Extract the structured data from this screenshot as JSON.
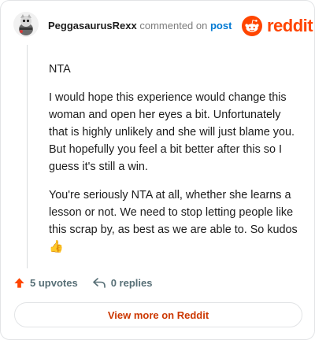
{
  "header": {
    "username": "PeggasaurusRexx",
    "verb": "commented on",
    "post_link": "post"
  },
  "brand": {
    "name": "reddit",
    "icon": "reddit-snoo-icon",
    "color": "#ff4500"
  },
  "comment": {
    "paragraphs": [
      "NTA",
      "I would hope this experience would change this woman and open her eyes a bit. Unfortunately that is highly unlikely and she will just blame you. But hopefully you feel a bit better after this so I guess it's still a win.",
      "You're seriously NTA at all, whether she learns a lesson or not. We need to stop letting people like this scrap by, as best as we are able to. So kudos"
    ],
    "emoji": "👍"
  },
  "actions": {
    "upvotes": "5 upvotes",
    "replies": "0 replies",
    "upvote_icon": "upvote-arrow-icon",
    "reply_icon": "reply-arrow-icon"
  },
  "cta": {
    "label": "View more on Reddit"
  }
}
